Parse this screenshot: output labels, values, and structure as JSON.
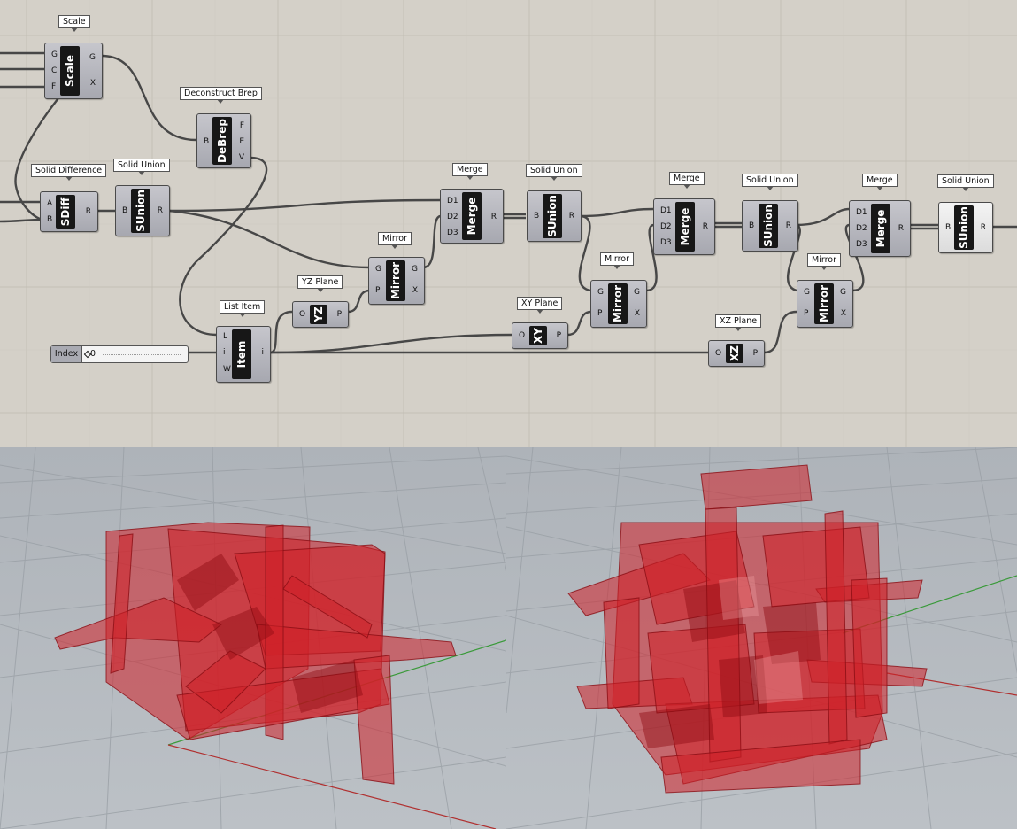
{
  "canvas": {
    "background": "#d4d0c8",
    "components": [
      {
        "id": "scale",
        "tag": "Scale",
        "core": "Scale",
        "inputs": [
          "G",
          "C",
          "F"
        ],
        "outputs": [
          "G",
          "X"
        ]
      },
      {
        "id": "debrep",
        "tag": "Deconstruct Brep",
        "core": "DeBrep",
        "inputs": [
          "B"
        ],
        "outputs": [
          "F",
          "E",
          "V"
        ]
      },
      {
        "id": "sdiff",
        "tag": "Solid Difference",
        "core": "SDiff",
        "inputs": [
          "A",
          "B"
        ],
        "outputs": [
          "R"
        ]
      },
      {
        "id": "sunion1",
        "tag": "Solid Union",
        "core": "SUnion",
        "inputs": [
          "B"
        ],
        "outputs": [
          "R"
        ]
      },
      {
        "id": "merge1",
        "tag": "Merge",
        "core": "Merge",
        "inputs": [
          "D1",
          "D2",
          "D3"
        ],
        "outputs": [
          "R"
        ]
      },
      {
        "id": "sunion2",
        "tag": "Solid Union",
        "core": "SUnion",
        "inputs": [
          "B"
        ],
        "outputs": [
          "R"
        ]
      },
      {
        "id": "mirror1",
        "tag": "Mirror",
        "core": "Mirror",
        "inputs": [
          "G",
          "P"
        ],
        "outputs": [
          "G",
          "X"
        ]
      },
      {
        "id": "yzplane",
        "tag": "YZ Plane",
        "core": "YZ",
        "inputs": [
          "O"
        ],
        "outputs": [
          "P"
        ]
      },
      {
        "id": "listitem",
        "tag": "List Item",
        "core": "Item",
        "inputs": [
          "L",
          "i",
          "W"
        ],
        "outputs": [
          "i"
        ]
      },
      {
        "id": "xyplane",
        "tag": "XY Plane",
        "core": "XY",
        "inputs": [
          "O"
        ],
        "outputs": [
          "P"
        ]
      },
      {
        "id": "mirror2",
        "tag": "Mirror",
        "core": "Mirror",
        "inputs": [
          "G",
          "P"
        ],
        "outputs": [
          "G",
          "X"
        ]
      },
      {
        "id": "merge2",
        "tag": "Merge",
        "core": "Merge",
        "inputs": [
          "D1",
          "D2",
          "D3"
        ],
        "outputs": [
          "R"
        ]
      },
      {
        "id": "sunion3",
        "tag": "Solid Union",
        "core": "SUnion",
        "inputs": [
          "B"
        ],
        "outputs": [
          "R"
        ]
      },
      {
        "id": "xzplane",
        "tag": "XZ Plane",
        "core": "XZ",
        "inputs": [
          "O"
        ],
        "outputs": [
          "P"
        ]
      },
      {
        "id": "mirror3",
        "tag": "Mirror",
        "core": "Mirror",
        "inputs": [
          "G",
          "P"
        ],
        "outputs": [
          "G",
          "X"
        ]
      },
      {
        "id": "merge3",
        "tag": "Merge",
        "core": "Merge",
        "inputs": [
          "D1",
          "D2",
          "D3"
        ],
        "outputs": [
          "R"
        ]
      },
      {
        "id": "sunion4",
        "tag": "Solid Union",
        "core": "SUnion",
        "inputs": [
          "B"
        ],
        "outputs": [
          "R"
        ]
      }
    ],
    "slider": {
      "label": "Index",
      "value": "0"
    }
  },
  "viewports": {
    "left": {
      "object": "red translucent mirrored solid (partial)"
    },
    "right": {
      "object": "red translucent mirrored solid (full symmetric)"
    },
    "colors": {
      "background": "#b4b9bf",
      "grid": "#9aa0a6",
      "solid": "#d02028",
      "x_axis": "#b03030",
      "y_axis": "#3a9a3a"
    }
  }
}
